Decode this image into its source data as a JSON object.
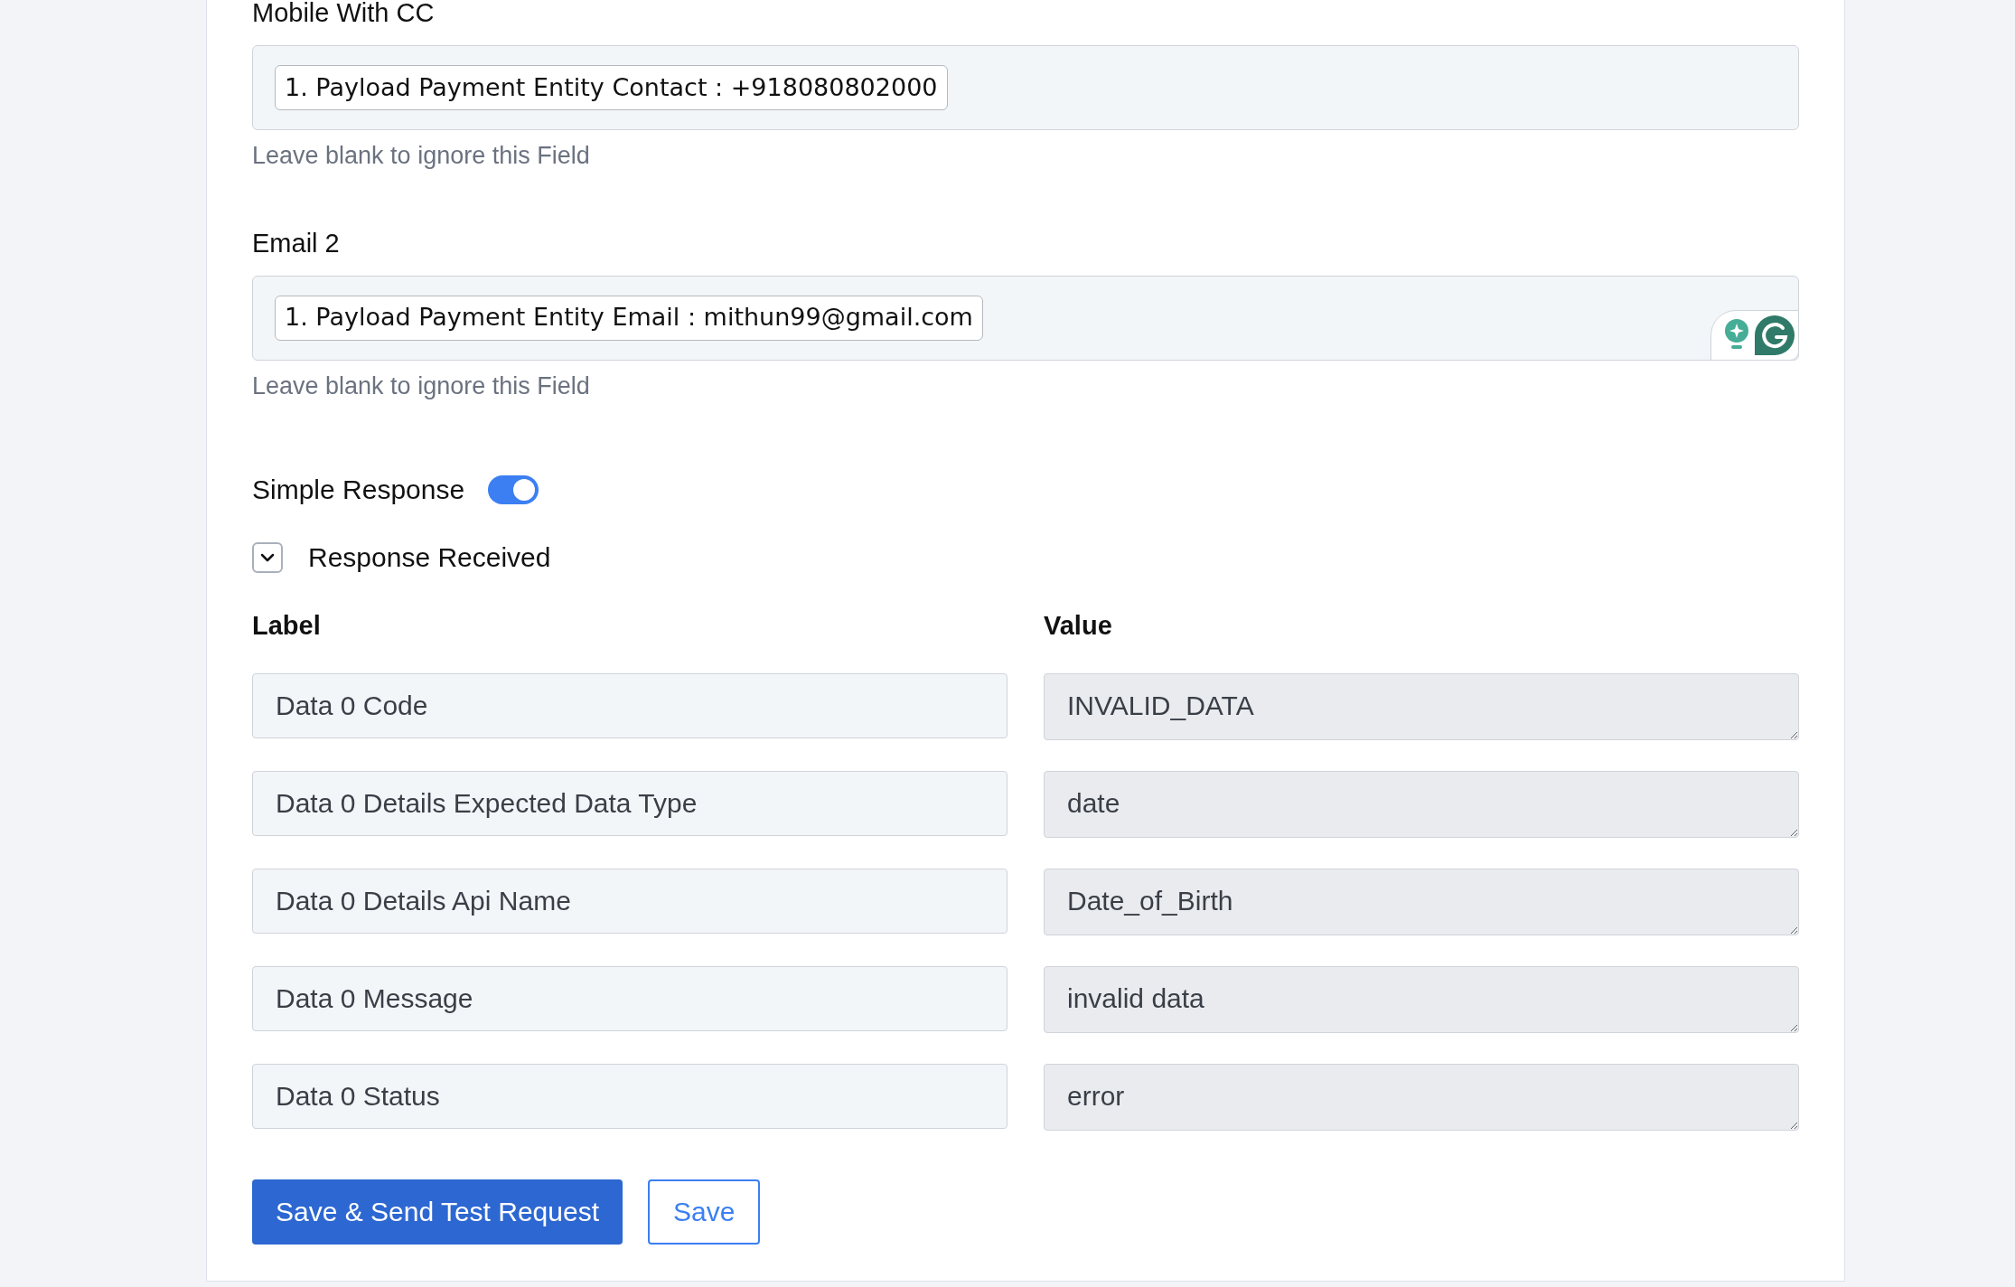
{
  "fields": [
    {
      "label": "Mobile With CC",
      "tags": [
        "1. Payload Payment Entity Contact : +918080802000"
      ],
      "hint": "Leave blank to ignore this Field",
      "assistant": false
    },
    {
      "label": "Email 2",
      "tags": [
        "1. Payload Payment Entity Email : mithun99@gmail.com"
      ],
      "hint": "Leave blank to ignore this Field",
      "assistant": true
    }
  ],
  "simple_response": {
    "label": "Simple Response",
    "on": true
  },
  "response": {
    "label": "Response Received",
    "expanded": true,
    "columns": [
      "Label",
      "Value"
    ],
    "rows": [
      {
        "label": "Data 0 Code",
        "value": "INVALID_DATA"
      },
      {
        "label": "Data 0 Details Expected Data Type",
        "value": "date"
      },
      {
        "label": "Data 0 Details Api Name",
        "value": "Date_of_Birth"
      },
      {
        "label": "Data 0 Message",
        "value": "invalid data"
      },
      {
        "label": "Data 0 Status",
        "value": "error"
      }
    ]
  },
  "buttons": [
    {
      "label": "Save & Send Test Request",
      "kind": "primary"
    },
    {
      "label": "Save",
      "kind": "outline"
    }
  ]
}
